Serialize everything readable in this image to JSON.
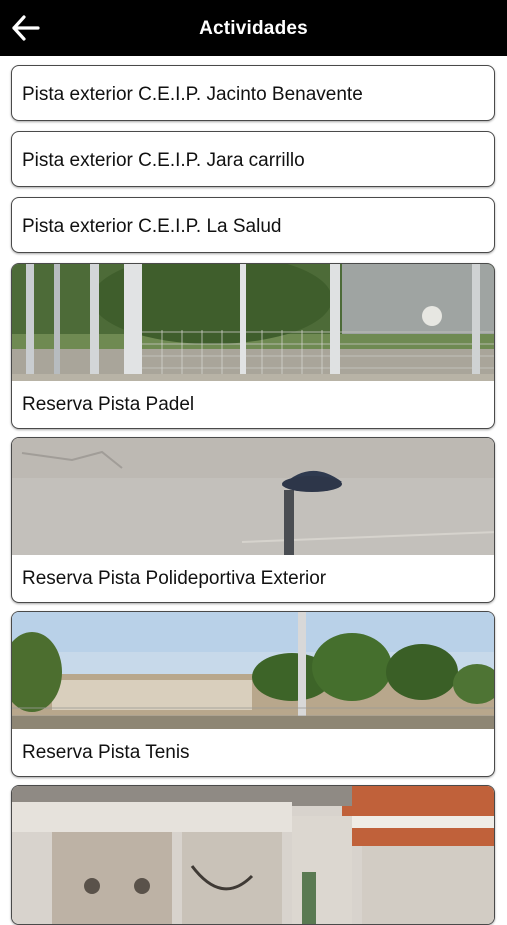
{
  "header": {
    "title": "Actividades",
    "back_icon": "arrow-left-icon"
  },
  "activities": [
    {
      "label": "Pista exterior C.E.I.P. Jacinto Benavente"
    },
    {
      "label": "Pista exterior C.E.I.P. Jara carrillo"
    },
    {
      "label": "Pista exterior C.E.I.P. La Salud"
    },
    {
      "label": "Reserva Pista Padel",
      "image": "padel-court-photo"
    },
    {
      "label": "Reserva Pista Polideportiva Exterior",
      "image": "sports-court-photo"
    },
    {
      "label": "Reserva Pista Tenis",
      "image": "tennis-court-photo"
    },
    {
      "image": "building-photo"
    }
  ],
  "colors": {
    "header_bg": "#000000",
    "header_text": "#ffffff",
    "card_border": "#4a4a4a"
  }
}
